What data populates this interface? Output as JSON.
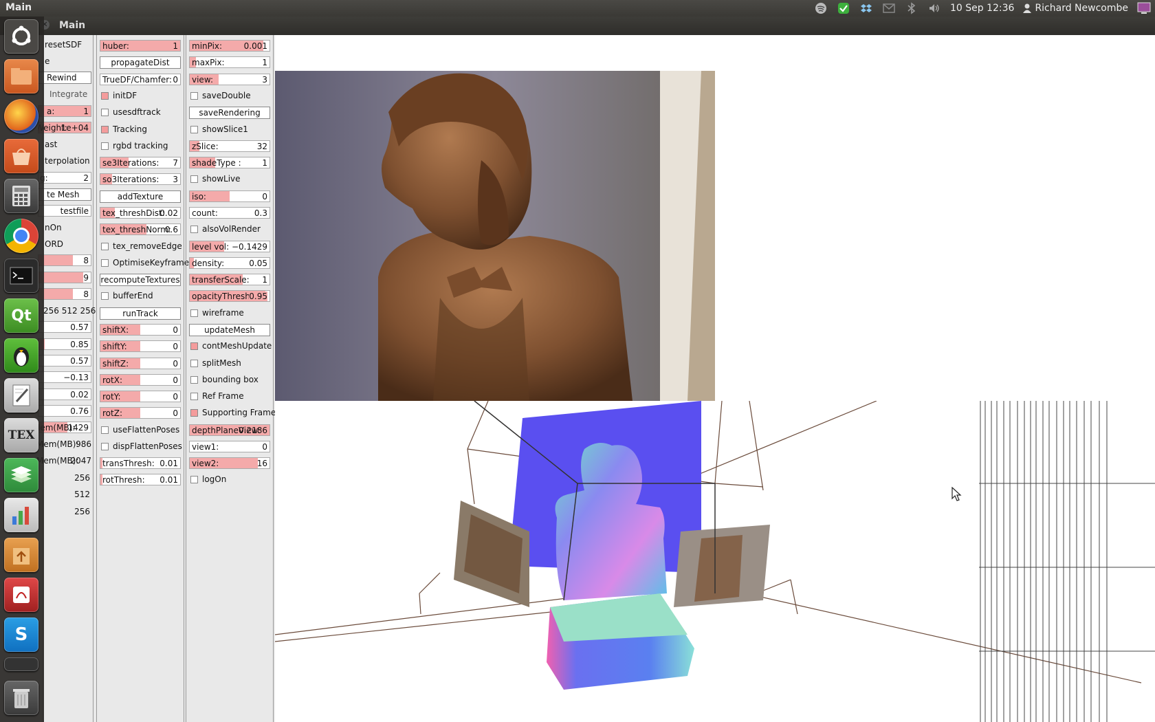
{
  "top_panel": {
    "title": "Main",
    "clock": "10 Sep 12:36",
    "user": "Richard Newcombe",
    "tray_icons": [
      "spotify-icon",
      "update-check-icon",
      "dropbox-icon",
      "mail-icon",
      "bluetooth-icon",
      "volume-icon"
    ]
  },
  "window": {
    "title": "Main"
  },
  "launcher": {
    "apps": [
      "ubuntu-dash",
      "files",
      "firefox",
      "software-center",
      "calculator",
      "chrome",
      "terminal",
      "qt-creator",
      "linux-tux",
      "text-editor",
      "texmaker",
      "stack-app",
      "monitor-app",
      "archive-app",
      "pdf-viewer",
      "skype",
      "workspaces",
      "trash"
    ],
    "tex_label": "TEX"
  },
  "col1": {
    "reset_sdf": "resetSDF",
    "mode": "e",
    "rewind": "Rewind",
    "integrate": "Integrate",
    "slider_a": {
      "label": "a:",
      "value": "1"
    },
    "weight": {
      "label": "Weight:",
      "value": "1e+04"
    },
    "cast": "ast",
    "interpolation": "terpolation",
    "slider_g": {
      "label": "g:",
      "value": "2"
    },
    "mesh_button": "te Mesh",
    "testfile": "testfile",
    "on": "nOn",
    "record": "ORD",
    "slider_8a": {
      "value": "8"
    },
    "slider_9": {
      "value": "9"
    },
    "slider_8b": {
      "value": "8"
    },
    "dims": "256 512 256",
    "v057a": "0.57",
    "v085": "0.85",
    "v057b": "0.57",
    "vneg013": "−0.13",
    "v002": "0.02",
    "v076": "0.76",
    "mem1": {
      "label": "Mem(MB):",
      "value": "1429"
    },
    "mem2": {
      "label": "Mem(MB):",
      "value": "986"
    },
    "mem3": {
      "label": "Mem(MB):",
      "value": "2047"
    },
    "n256a": "256",
    "n512": "512",
    "n256b": "256"
  },
  "col2": {
    "huber": {
      "label": "huber:",
      "value": "1"
    },
    "propagate_dist": "propagateDist",
    "true_df": {
      "label": "TrueDF/Chamfer:",
      "value": "0"
    },
    "init_df": "initDF",
    "use_sdf_track": "usesdftrack",
    "tracking": "Tracking",
    "rgbd_tracking": "rgbd tracking",
    "se3": {
      "label": "se3Iterations:",
      "value": "7"
    },
    "so3": {
      "label": "so3Iterations:",
      "value": "3"
    },
    "add_texture": "addTexture",
    "tex_thresh_dist": {
      "label": "tex_threshDist:",
      "value": "0.02"
    },
    "tex_thresh_norm": {
      "label": "tex_threshNorm:",
      "value": "0.6"
    },
    "tex_remove_edge": "tex_removeEdge",
    "optimise_keyframes": "OptimiseKeyframes",
    "recompute_textures": "recomputeTextures",
    "buffer_end": "bufferEnd",
    "run_track": "runTrack",
    "shift_x": {
      "label": "shiftX:",
      "value": "0"
    },
    "shift_y": {
      "label": "shiftY:",
      "value": "0"
    },
    "shift_z": {
      "label": "shiftZ:",
      "value": "0"
    },
    "rot_x": {
      "label": "rotX:",
      "value": "0"
    },
    "rot_y": {
      "label": "rotY:",
      "value": "0"
    },
    "rot_z": {
      "label": "rotZ:",
      "value": "0"
    },
    "use_flatten_poses": "useFlattenPoses",
    "disp_flatten_poses": "dispFlattenPoses",
    "trans_thresh": {
      "label": "transThresh:",
      "value": "0.01"
    },
    "rot_thresh": {
      "label": "rotThresh:",
      "value": "0.01"
    }
  },
  "col3": {
    "min_pix": {
      "label": "minPix:",
      "value": "0.001"
    },
    "max_pix": {
      "label": "maxPix:",
      "value": "1"
    },
    "view": {
      "label": "view:",
      "value": "3"
    },
    "save_double": "saveDouble",
    "save_rendering": "saveRendering",
    "show_slice1": "showSlice1",
    "z_slice": {
      "label": "zSlice:",
      "value": "32"
    },
    "shade_type": {
      "label": "shadeType :",
      "value": "1"
    },
    "show_live": "showLive",
    "iso": {
      "label": "iso:",
      "value": "0"
    },
    "count": {
      "label": "count:",
      "value": "0.3"
    },
    "also_vol_render": "alsoVolRender",
    "level_vol": {
      "label": "level vol:",
      "value": "−0.1429"
    },
    "density": {
      "label": "density:",
      "value": "0.05"
    },
    "transfer_scale": {
      "label": "transferScale:",
      "value": "1"
    },
    "opacity_threshold": {
      "label": "opacityThreshold:",
      "value": "0.95"
    },
    "wireframe": "wireframe",
    "update_mesh": "updateMesh",
    "cont_mesh_update": "contMeshUpdate",
    "split_mesh": "splitMesh",
    "bounding_box": "bounding box",
    "ref_frame": "Ref Frame",
    "supporting_frames": "Supporting Frames",
    "depth_plane_view": {
      "label": "depthPlaneView:",
      "value": "0.2186"
    },
    "view1": {
      "label": "view1:",
      "value": "0"
    },
    "view2": {
      "label": "view2:",
      "value": "16"
    },
    "log_on": "logOn"
  },
  "colors": {
    "slider_fill": "#f4aaaa",
    "checkbox_on": "#f49c9c",
    "normal_plane": "#5a4ff0",
    "panel_bg": "#e9e9e9"
  }
}
